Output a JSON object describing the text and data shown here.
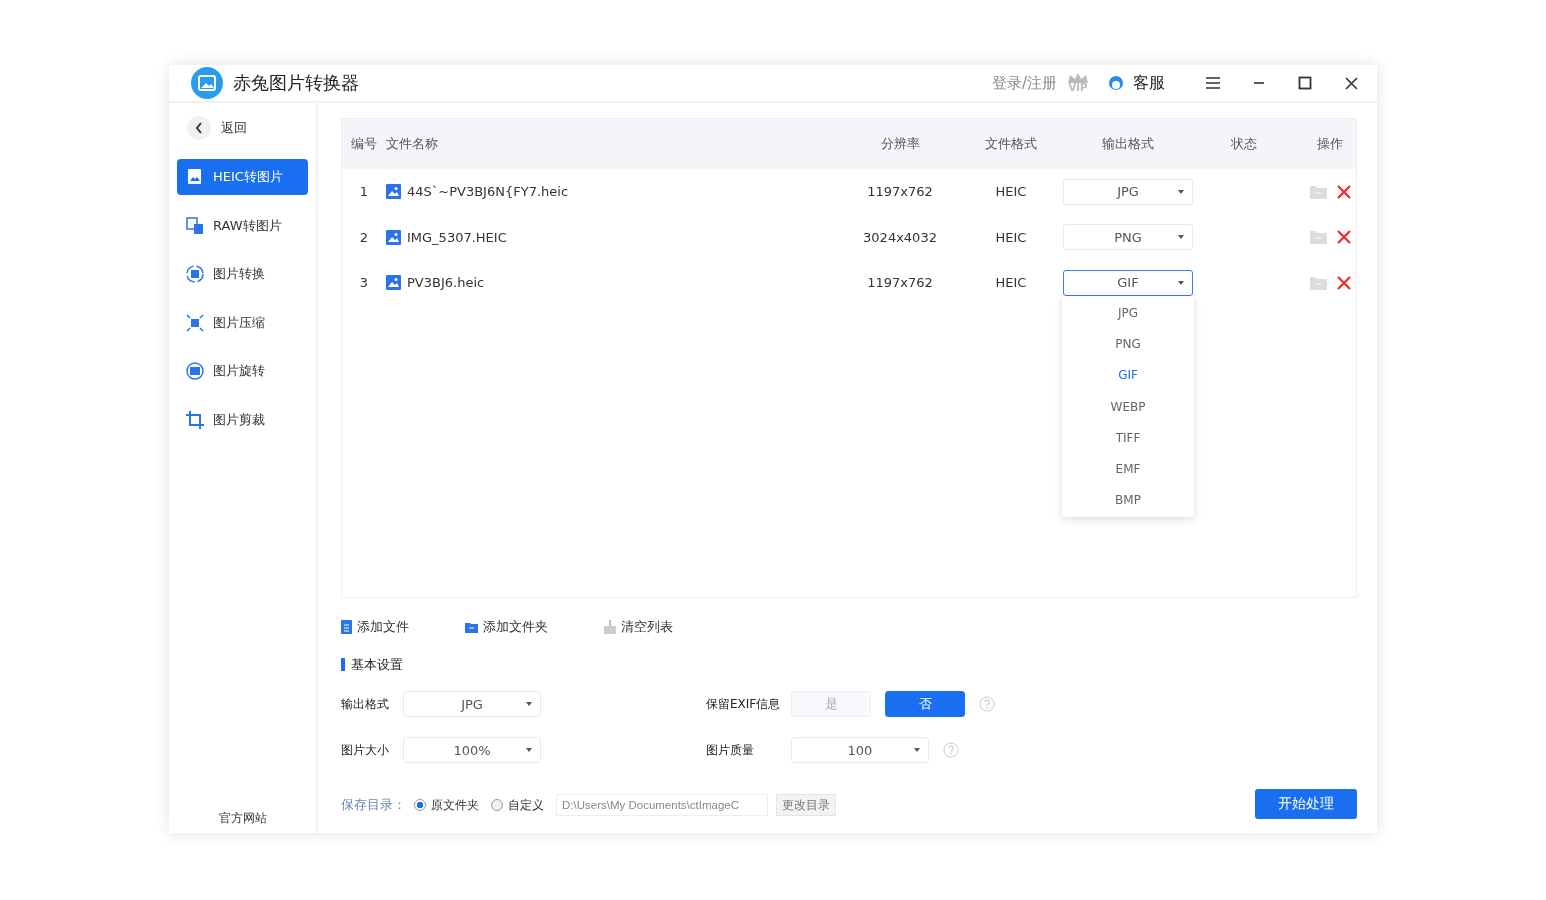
{
  "window": {
    "title": "赤兔图片转换器",
    "login": "登录/注册",
    "vip": "VIP",
    "service": "客服"
  },
  "sidebar": {
    "back": "返回",
    "items": [
      {
        "label": "HEIC转图片",
        "selected": true,
        "kind": "heic"
      },
      {
        "label": "RAW转图片",
        "selected": false,
        "kind": "raw"
      },
      {
        "label": "图片转换",
        "selected": false,
        "kind": "convert"
      },
      {
        "label": "图片压缩",
        "selected": false,
        "kind": "compress"
      },
      {
        "label": "图片旋转",
        "selected": false,
        "kind": "rotate"
      },
      {
        "label": "图片剪裁",
        "selected": false,
        "kind": "crop"
      }
    ],
    "footer": "官方网站"
  },
  "table": {
    "columns": [
      "编号",
      "文件名称",
      "分辨率",
      "文件格式",
      "输出格式",
      "状态",
      "操作"
    ],
    "rows": [
      {
        "index": "1",
        "name": "44S`~PV3BJ6N{FY7.heic",
        "resolution": "1197x762",
        "format": "HEIC",
        "output": "JPG",
        "focused": false
      },
      {
        "index": "2",
        "name": "IMG_5307.HEIC",
        "resolution": "3024x4032",
        "format": "HEIC",
        "output": "PNG",
        "focused": false
      },
      {
        "index": "3",
        "name": "PV3BJ6.heic",
        "resolution": "1197x762",
        "format": "HEIC",
        "output": "GIF",
        "focused": true
      }
    ]
  },
  "dropdown_menu": [
    {
      "label": "JPG",
      "selected": false
    },
    {
      "label": "PNG",
      "selected": false
    },
    {
      "label": "GIF",
      "selected": true
    },
    {
      "label": "WEBP",
      "selected": false
    },
    {
      "label": "TIFF",
      "selected": false
    },
    {
      "label": "EMF",
      "selected": false
    },
    {
      "label": "BMP",
      "selected": false
    }
  ],
  "actions": [
    {
      "label": "添加文件",
      "kind": "file"
    },
    {
      "label": "添加文件夹",
      "kind": "folder"
    },
    {
      "label": "清空列表",
      "kind": "clear"
    }
  ],
  "settings": {
    "title": "基本设置",
    "output_format": {
      "label": "输出格式",
      "value": "JPG"
    },
    "exif": {
      "label": "保留EXIF信息",
      "options": [
        {
          "label": "是",
          "selected": false
        },
        {
          "label": "否",
          "selected": true
        }
      ]
    },
    "size": {
      "label": "图片大小",
      "value": "100%"
    },
    "quality": {
      "label": "图片质量",
      "value": "100"
    }
  },
  "save": {
    "label": "保存目录：",
    "options": [
      {
        "label": "原文件夹",
        "selected": true
      },
      {
        "label": "自定义",
        "selected": false
      }
    ],
    "path": "D:\\Users\\My Documents\\ctImageC",
    "change": "更改目录"
  },
  "start": "开始处理"
}
